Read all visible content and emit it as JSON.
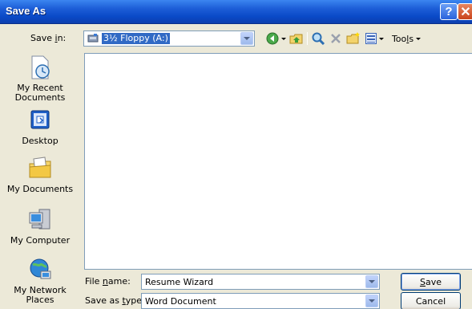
{
  "window": {
    "title": "Save As",
    "help_glyph": "?",
    "close_glyph": "✕"
  },
  "save_in": {
    "label_pre": "Save ",
    "label_key": "i",
    "label_post": "n:",
    "value": "3½ Floppy (A:)",
    "icon": "floppy-drive-icon"
  },
  "toolbar": {
    "buttons": [
      "back-icon",
      "up-one-level-icon",
      "search-web-icon",
      "delete-icon",
      "create-new-folder-icon",
      "views-icon"
    ],
    "tools_pre": "Too",
    "tools_key": "l",
    "tools_post": "s"
  },
  "places": [
    {
      "label": "My Recent Documents",
      "icon": "my-recent-documents-icon"
    },
    {
      "label": "Desktop",
      "icon": "desktop-icon"
    },
    {
      "label": "My Documents",
      "icon": "my-documents-icon"
    },
    {
      "label": "My Computer",
      "icon": "my-computer-icon"
    },
    {
      "label": "My Network Places",
      "icon": "my-network-places-icon"
    }
  ],
  "file_name": {
    "label_pre": "File ",
    "label_key": "n",
    "label_post": "ame:",
    "value": "Resume Wizard"
  },
  "save_as_type": {
    "label_pre": "Save as ",
    "label_key": "t",
    "label_post": "ype:",
    "value": "Word Document"
  },
  "buttons": {
    "save_key": "S",
    "save_rest": "ave",
    "cancel": "Cancel"
  },
  "colors": {
    "titlebar": "#0a4ac8",
    "dialog_bg": "#ece9d8",
    "selection": "#316ac5",
    "field_border": "#7f9db9"
  }
}
